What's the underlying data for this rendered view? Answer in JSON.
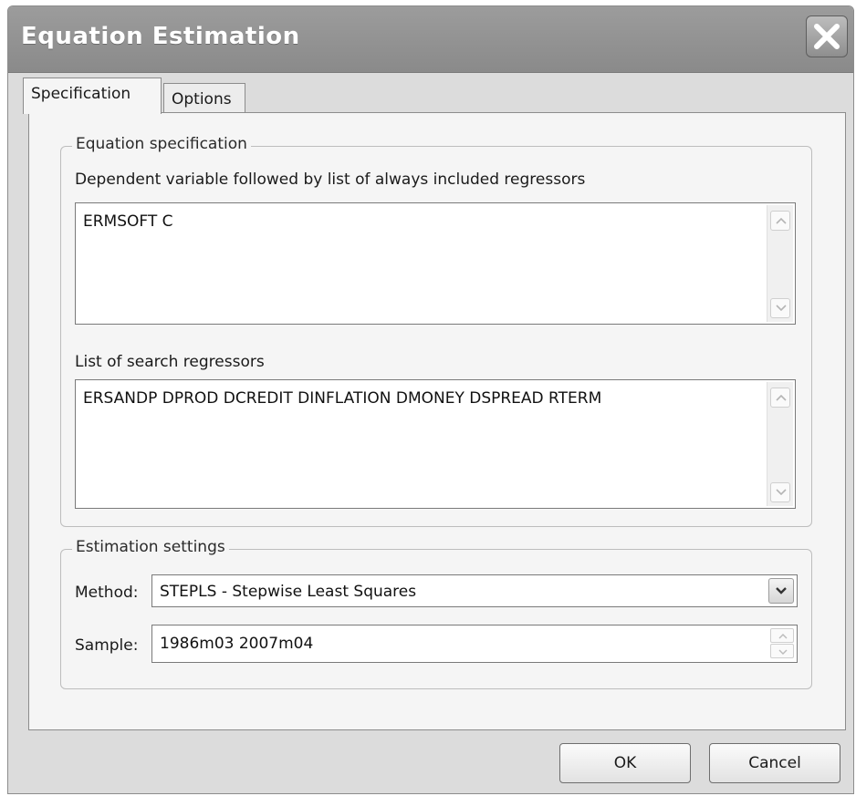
{
  "window": {
    "title": "Equation Estimation"
  },
  "tabs": [
    {
      "label": "Specification",
      "active": true
    },
    {
      "label": "Options",
      "active": false
    }
  ],
  "equation_spec": {
    "legend": "Equation specification",
    "dependent_label": "Dependent variable followed by list of always included regressors",
    "dependent_value": "ERMSOFT C",
    "search_label": "List of search regressors",
    "search_value": "ERSANDP DPROD DCREDIT DINFLATION DMONEY DSPREAD RTERM"
  },
  "estimation_settings": {
    "legend": "Estimation settings",
    "method_label": "Method:",
    "method_value": "STEPLS - Stepwise Least Squares",
    "sample_label": "Sample:",
    "sample_value": "1986m03 2007m04"
  },
  "buttons": {
    "ok": "OK",
    "cancel": "Cancel"
  },
  "icons": {
    "close": "close-icon",
    "scroll_up": "chevron-up-icon",
    "scroll_down": "chevron-down-icon",
    "dropdown": "chevron-down-icon"
  }
}
